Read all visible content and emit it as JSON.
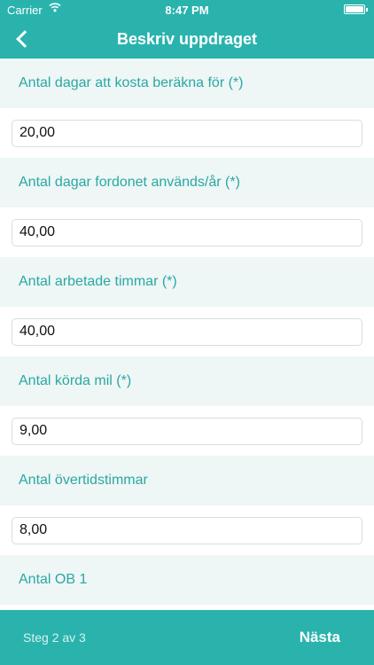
{
  "status_bar": {
    "carrier": "Carrier",
    "wifi_icon": "wifi-icon",
    "time": "8:47 PM",
    "battery_icon": "battery-icon"
  },
  "nav": {
    "title": "Beskriv uppdraget",
    "back_icon": "chevron-left-icon"
  },
  "fields": [
    {
      "label": "Antal dagar att kosta beräkna för (*)",
      "value": "20,00"
    },
    {
      "label": "Antal dagar fordonet används/år (*)",
      "value": "40,00"
    },
    {
      "label": "Antal arbetade timmar (*)",
      "value": "40,00"
    },
    {
      "label": "Antal körda mil (*)",
      "value": "9,00"
    },
    {
      "label": "Antal övertidstimmar",
      "value": "8,00"
    },
    {
      "label": "Antal OB 1",
      "value": ""
    }
  ],
  "footer": {
    "step": "Steg 2 av 3",
    "next_label": "Nästa"
  },
  "colors": {
    "accent": "#2ab3ad",
    "label_background": "#eef6f6",
    "label_text": "#2aa8a2"
  }
}
